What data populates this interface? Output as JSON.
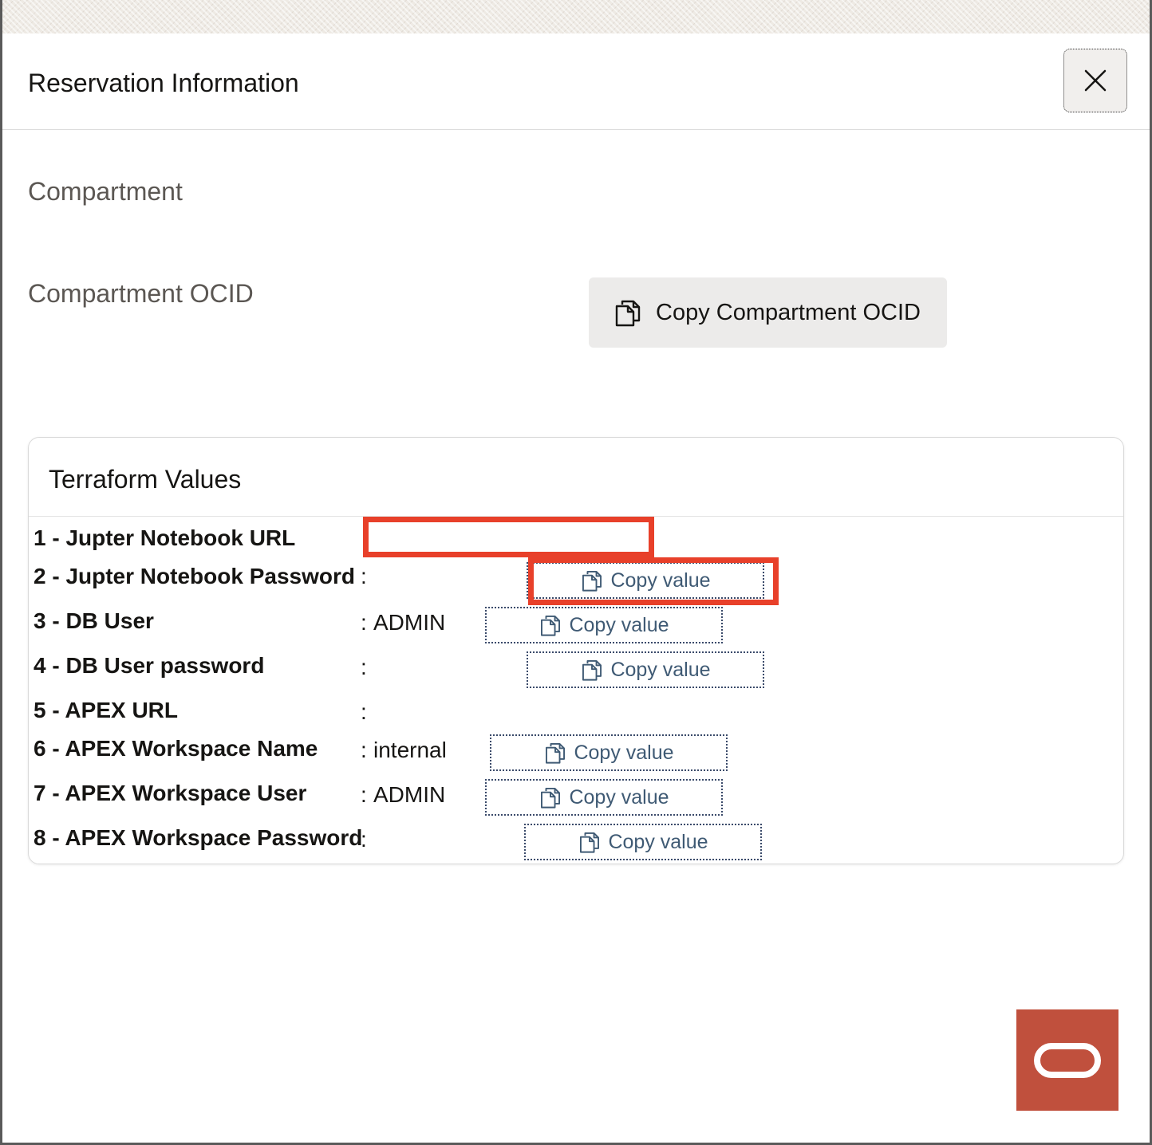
{
  "dialog": {
    "title": "Reservation Information",
    "close_icon": "close-icon"
  },
  "compartment": {
    "label": "Compartment",
    "ocid_label": "Compartment OCID",
    "copy_ocid_button": "Copy Compartment OCID",
    "copy_icon": "copy-icon"
  },
  "terraform": {
    "title": "Terraform Values",
    "colon": ":",
    "copy_label": "Copy value",
    "rows": [
      {
        "label": "1 - Jupter Notebook URL",
        "value": ""
      },
      {
        "label": "2 - Jupter Notebook Password",
        "value": ""
      },
      {
        "label": "3 - DB User",
        "value": "ADMIN"
      },
      {
        "label": "4 - DB User password",
        "value": ""
      },
      {
        "label": "5 - APEX URL",
        "value": ""
      },
      {
        "label": "6 - APEX Workspace Name",
        "value": "internal"
      },
      {
        "label": "7 - APEX Workspace User",
        "value": "ADMIN"
      },
      {
        "label": "8 - APEX Workspace Password",
        "value": ""
      }
    ]
  },
  "colors": {
    "annotation_red": "#e8402a",
    "oracle_brand": "#c0503d",
    "copy_text": "#3f5a74"
  },
  "brand": {
    "icon": "oracle-logo-icon"
  }
}
